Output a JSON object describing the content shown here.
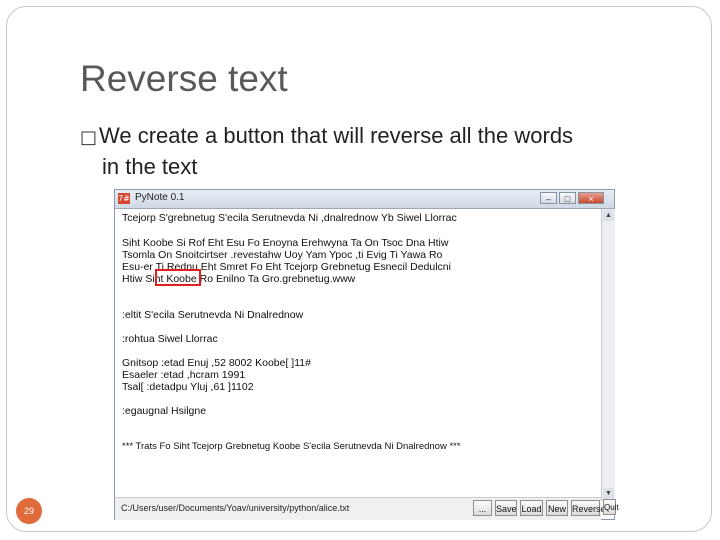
{
  "slide": {
    "title": "Reverse text",
    "bullet_mark": "□",
    "bullet_line1": "We create a button that will reverse all the words",
    "bullet_line2": "in the text",
    "page_number": "29"
  },
  "window": {
    "app_icon": "7#",
    "title": "PyNote 0.1",
    "controls": {
      "minimize": "–",
      "maximize": "□",
      "close": "×"
    },
    "editor_lines": [
      "Tcejorp S'grebnetug S'ecila Serutnevda Ni ,dnalrednow Yb Siwel Llorrac",
      "",
      "Siht Koobe Si Rof Eht Esu Fo Enoyna Erehwyna Ta On Tsoc Dna Htiw",
      "Tsomla On Snoitcirtser .revestahw Uoy Yam Ypoc ,ti Evig Ti Yawa Ro",
      "Esu-er Ti Rednu Eht Smret Fo Eht Tcejorp Grebnetug Esnecil Dedulcni",
      "Htiw Siht Koobe Ro Enilno Ta Gro.grebnetug.www",
      "",
      "",
      ":eltit S'ecila Serutnevda Ni Dnalrednow",
      "",
      ":rohtua Siwel Llorrac",
      "",
      "Gnitsop :etad Enuj ,52 8002 Koobe[ ]11#",
      "Esaeler :etad ,hcram 1991",
      "Tsal[ :detadpu Yluj ,61 ]1102",
      "",
      ":egaugnal Hsilgne",
      "",
      "",
      "*** Trats Fo Siht Tcejorp Grebnetug Koobe S'ecila Serutnevda Ni Dnalrednow ***"
    ],
    "path": "C:/Users/user/Documents/Yoav/university/python/alice.txt",
    "buttons": [
      "...",
      "Save",
      "Load",
      "New",
      "Reverse",
      "Quit"
    ]
  }
}
